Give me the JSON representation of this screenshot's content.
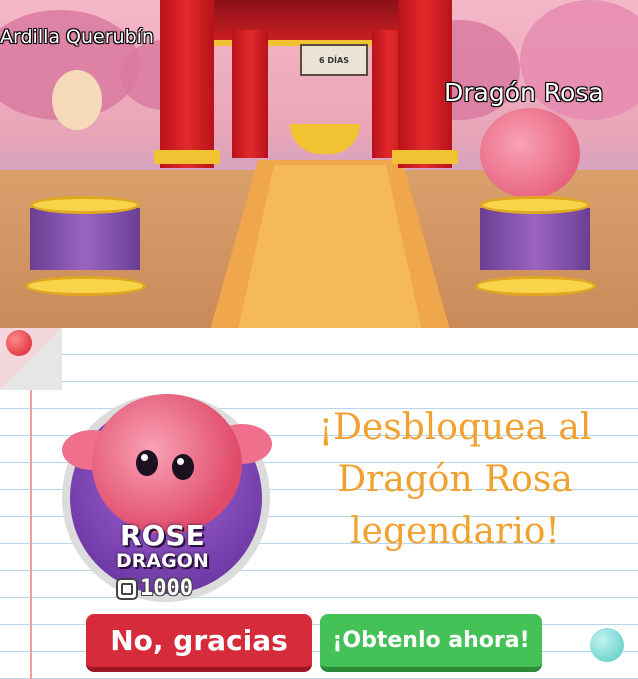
{
  "scene": {
    "name_left": "Ardilla Querubín",
    "name_right": "Dragón Rosa",
    "sign_text": "6 DÍAS"
  },
  "offer": {
    "headline_lines": [
      "¡Desbloquea al",
      "Dragón Rosa",
      "legendario!"
    ],
    "badge_line1": "ROSE",
    "badge_line2": "DRAGON",
    "price_icon": "robux-icon",
    "price": "1000",
    "decline_label": "No, gracias",
    "accept_label": "¡Obtenlo ahora!"
  },
  "colors": {
    "headline": "#f2a12e",
    "decline_button": "#d62b3b",
    "accept_button": "#44c157",
    "badge_background": "#5b2a95"
  }
}
